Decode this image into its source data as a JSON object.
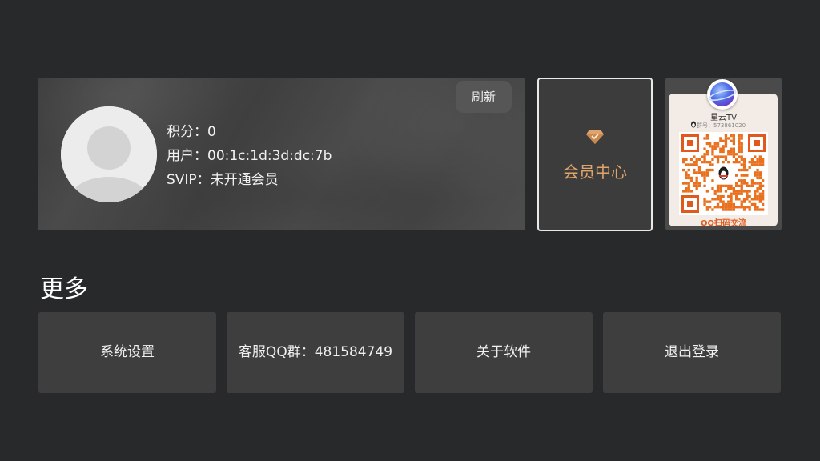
{
  "profile": {
    "points_label": "积分：",
    "points_value": "0",
    "user_label": "用户：",
    "user_value": "00:1c:1d:3d:dc:7b",
    "svip_label": "SVIP：",
    "svip_value": "未开通会员",
    "refresh_label": "刷新",
    "avatar_icon": "default-user-avatar"
  },
  "member_center": {
    "label": "会员中心",
    "icon": "diamond-icon",
    "color": "#e0a36a"
  },
  "qr_panel": {
    "title": "星云TV",
    "group_no": "群号：573861020",
    "caption": "QQ扫码交流",
    "accent_color": "#e05a1e"
  },
  "more": {
    "title": "更多",
    "buttons": [
      {
        "label": "系统设置"
      },
      {
        "label": "客服QQ群：481584749"
      },
      {
        "label": "关于软件"
      },
      {
        "label": "退出登录"
      }
    ]
  },
  "colors": {
    "background": "#28292b",
    "card": "#3e3e3e"
  }
}
